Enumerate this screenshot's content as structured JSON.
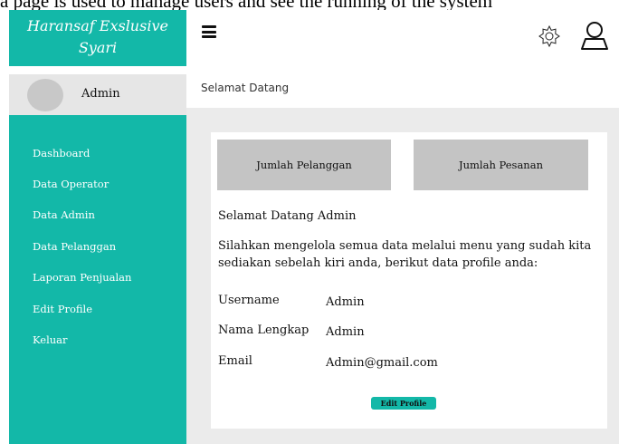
{
  "caption": "a page is used to manage users and see the running of the system",
  "brand": {
    "line1": "Haransaf Exslusive",
    "line2": "Syari"
  },
  "user": {
    "name": "Admin"
  },
  "menu": {
    "items": [
      "Dashboard",
      "Data Operator",
      "Data Admin",
      "Data Pelanggan",
      "Laporan Penjualan",
      "Edit Profile",
      "Keluar"
    ]
  },
  "breadcrumb": "Selamat Datang",
  "stats": {
    "customers_label": "Jumlah Pelanggan",
    "orders_label": "Jumlah Pesanan"
  },
  "content": {
    "welcome": "Selamat Datang Admin",
    "description": "Silahkan mengelola semua data melalui menu yang sudah kita sediakan sebelah kiri anda, berikut data profile anda:",
    "profile": {
      "username_label": "Username",
      "username_value": "Admin",
      "fullname_label": "Nama Lengkap",
      "fullname_value": "Admin",
      "email_label": "Email",
      "email_value": "Admin@gmail.com"
    },
    "edit_button": "Edit Profile"
  },
  "icons": {
    "menu": "hamburger-icon",
    "settings": "gear-icon",
    "account": "user-icon"
  },
  "colors": {
    "accent": "#13b8a8",
    "panel": "#e6e6e6",
    "stat_box": "#c4c4c4",
    "background": "#ebebeb"
  }
}
